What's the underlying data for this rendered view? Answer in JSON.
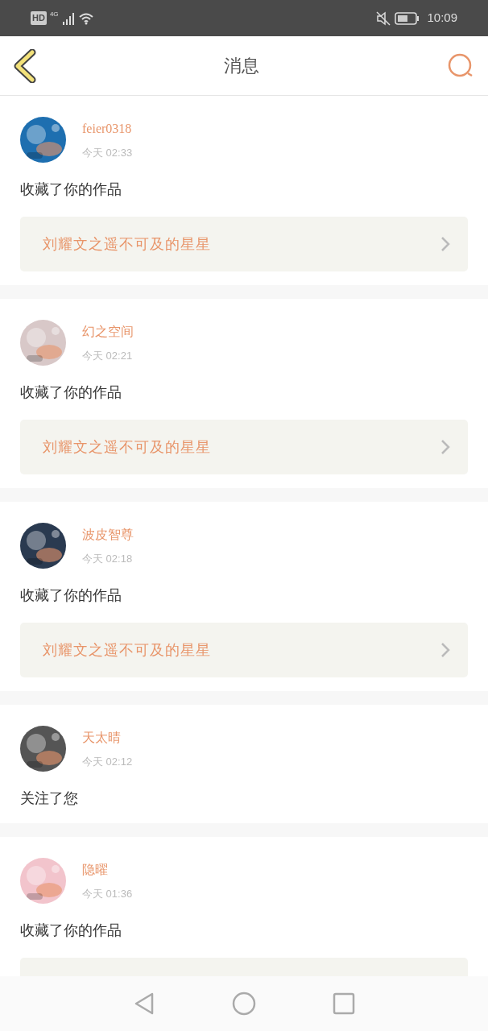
{
  "status_bar": {
    "hd": "HD",
    "network": "4G",
    "time": "10:09"
  },
  "header": {
    "title": "消息"
  },
  "messages": [
    {
      "kind": "favorite",
      "user": "feier0318",
      "time": "今天 02:33",
      "action": "收藏了你的作品",
      "work": "刘耀文之遥不可及的星星"
    },
    {
      "kind": "favorite",
      "user": "幻之空间",
      "time": "今天 02:21",
      "action": "收藏了你的作品",
      "work": "刘耀文之遥不可及的星星"
    },
    {
      "kind": "favorite",
      "user": "波皮智尊",
      "time": "今天 02:18",
      "action": "收藏了你的作品",
      "work": "刘耀文之遥不可及的星星"
    },
    {
      "kind": "follow",
      "user": "天太晴",
      "time": "今天 02:12",
      "action": "关注了您"
    },
    {
      "kind": "favorite",
      "user": "隐曜",
      "time": "今天 01:36",
      "action": "收藏了你的作品"
    }
  ]
}
